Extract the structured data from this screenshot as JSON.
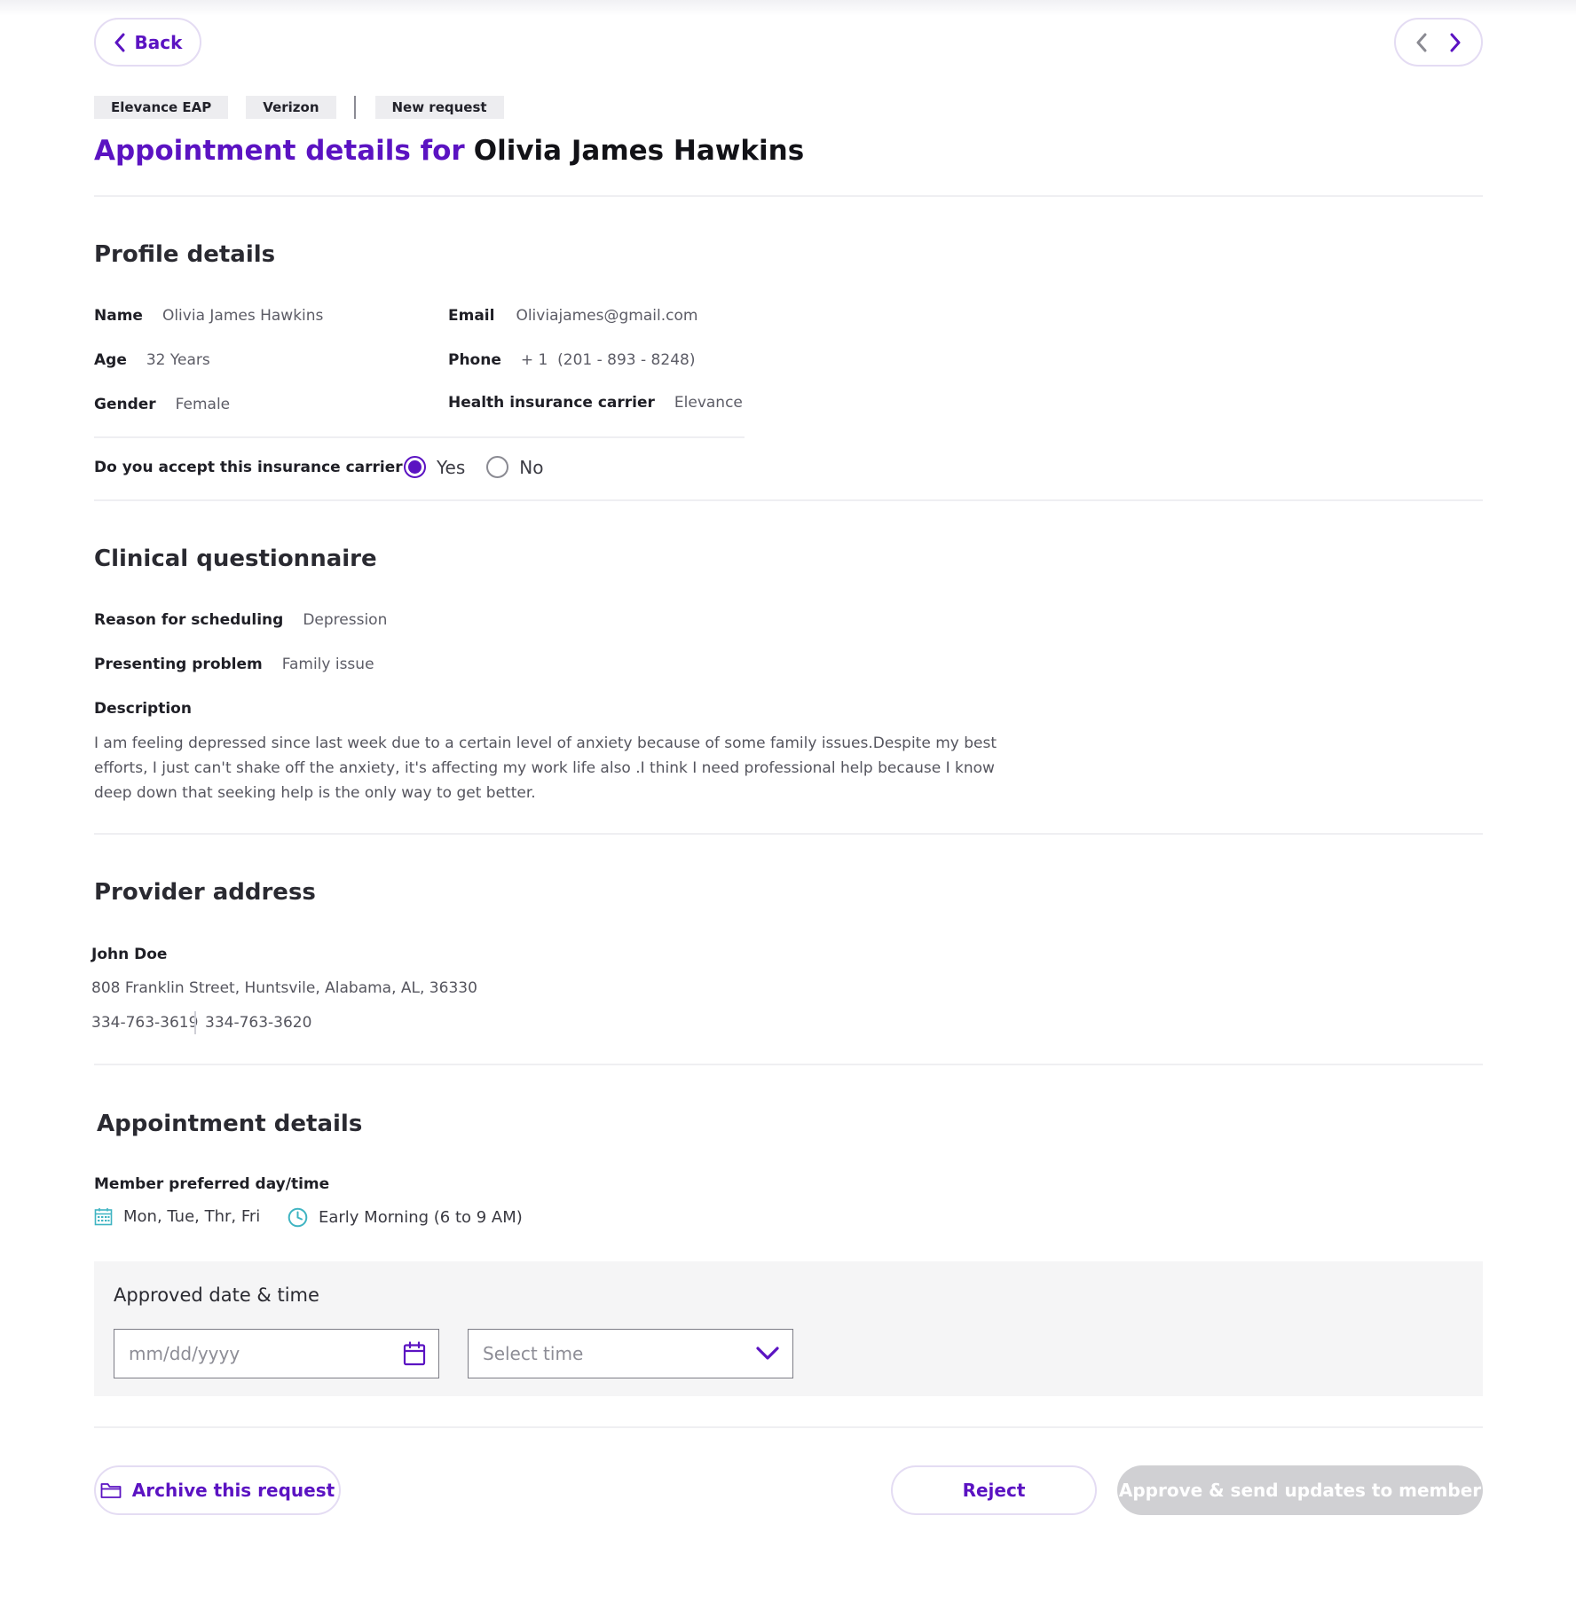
{
  "nav": {
    "back_label": "Back",
    "prev_icon": "chevron-left-icon",
    "next_icon": "chevron-right-icon"
  },
  "tags": [
    "Elevance EAP",
    "Verizon",
    "New request"
  ],
  "title": {
    "prefix": "Appointment details for",
    "name": "Olivia James Hawkins"
  },
  "profile": {
    "heading": "Profile details",
    "name_label": "Name",
    "name_value": "Olivia James Hawkins",
    "age_label": "Age",
    "age_value": "32 Years",
    "gender_label": "Gender",
    "gender_value": "Female",
    "email_label": "Email",
    "email_value": "Oliviajames@gmail.com",
    "phone_label": "Phone",
    "phone_value": "+ 1  (201 - 893 - 8248)",
    "carrier_label": "Health insurance carrier",
    "carrier_value": "Elevance",
    "accept_question": "Do you accept this insurance carrier",
    "accept_yes": "Yes",
    "accept_no": "No",
    "accept_selected": "Yes"
  },
  "clinical": {
    "heading": "Clinical questionnaire",
    "reason_label": "Reason for scheduling",
    "reason_value": "Depression",
    "problem_label": "Presenting problem",
    "problem_value": "Family issue",
    "description_label": "Description",
    "description_text": "I am feeling depressed since last week due to a certain level of anxiety because of some family issues.Despite my best efforts, I just can't shake off the anxiety, it's affecting my work life also .I think I need professional help because I know deep down that seeking help is the only way to get better."
  },
  "provider": {
    "heading": "Provider address",
    "name": "John Doe",
    "address": "808 Franklin Street, Huntsvile, Alabama, AL, 36330",
    "phone_1": "334-763-3619",
    "phone_2": "334-763-3620"
  },
  "appointment": {
    "heading": "Appointment details",
    "preferred_label": "Member preferred day/time",
    "preferred_days": "Mon, Tue, Thr, Fri",
    "preferred_time": "Early Morning (6 to 9 AM)",
    "approved_title": "Approved date & time",
    "date_placeholder": "mm/dd/yyyy",
    "time_placeholder": "Select time"
  },
  "actions": {
    "archive_label": "Archive this request",
    "reject_label": "Reject",
    "approve_label": "Approve & send updates to member"
  },
  "colors": {
    "accent": "#5b13c2",
    "icon_teal": "#3fb4c2",
    "disabled_button": "#d0d0d3"
  }
}
